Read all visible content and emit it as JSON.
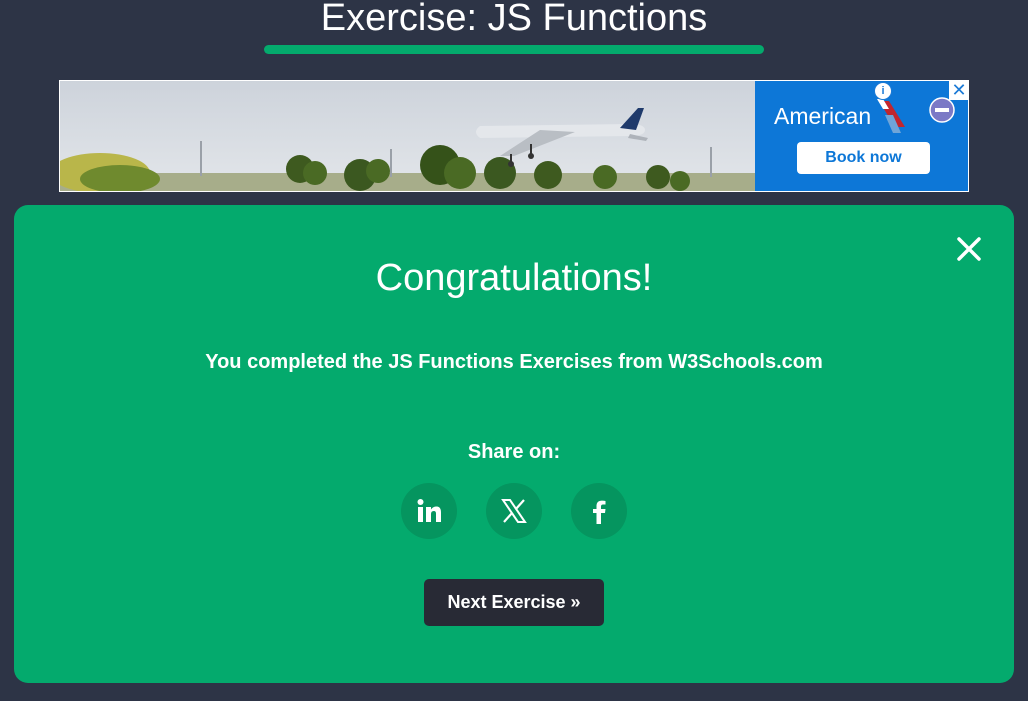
{
  "page": {
    "title": "Exercise: JS Functions",
    "progress_percent": 100
  },
  "ad": {
    "brand_name": "American",
    "cta_label": "Book now",
    "info_icon": "info-icon",
    "close_icon": "close-icon",
    "photo_subject": "airplane-takeoff-photo",
    "colors": {
      "brand_panel": "#0d77d7"
    }
  },
  "modal": {
    "heading": "Congratulations!",
    "message": "You completed the JS Functions Exercises from W3Schools.com",
    "share_label": "Share on:",
    "share_buttons": [
      {
        "name": "LinkedIn",
        "icon": "linkedin-icon"
      },
      {
        "name": "X",
        "icon": "x-icon"
      },
      {
        "name": "Facebook",
        "icon": "facebook-icon"
      }
    ],
    "next_label": "Next Exercise »",
    "close_icon": "close-icon",
    "colors": {
      "background": "#04aa6d",
      "next_button": "#282a35"
    }
  }
}
